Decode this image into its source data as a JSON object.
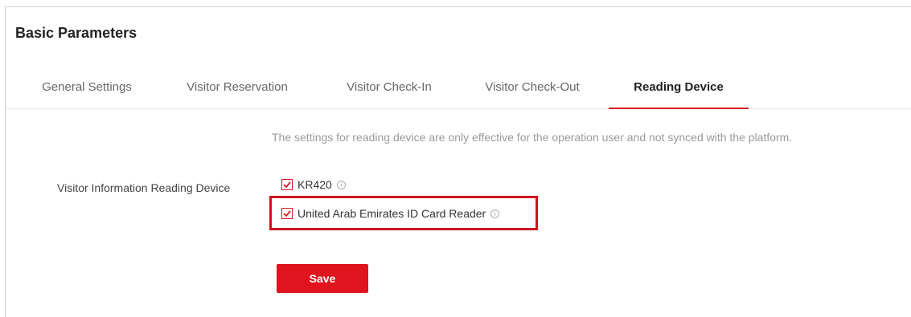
{
  "page": {
    "title": "Basic Parameters"
  },
  "tabs": [
    {
      "label": "General Settings"
    },
    {
      "label": "Visitor Reservation"
    },
    {
      "label": "Visitor Check-In"
    },
    {
      "label": "Visitor Check-Out"
    },
    {
      "label": "Reading Device",
      "active": true
    }
  ],
  "notice": "The settings for reading device are only effective for the operation user and not synced with the platform.",
  "reading_device": {
    "label": "Visitor Information Reading Device",
    "options": [
      {
        "label": "KR420",
        "checked": true,
        "info_icon": "info-circle-icon"
      },
      {
        "label": "United Arab Emirates ID Card Reader",
        "checked": true,
        "info_icon": "info-circle-icon",
        "highlighted": true
      }
    ]
  },
  "save_label": "Save",
  "colors": {
    "accent": "#e0141e",
    "highlight": "#d0101e"
  }
}
